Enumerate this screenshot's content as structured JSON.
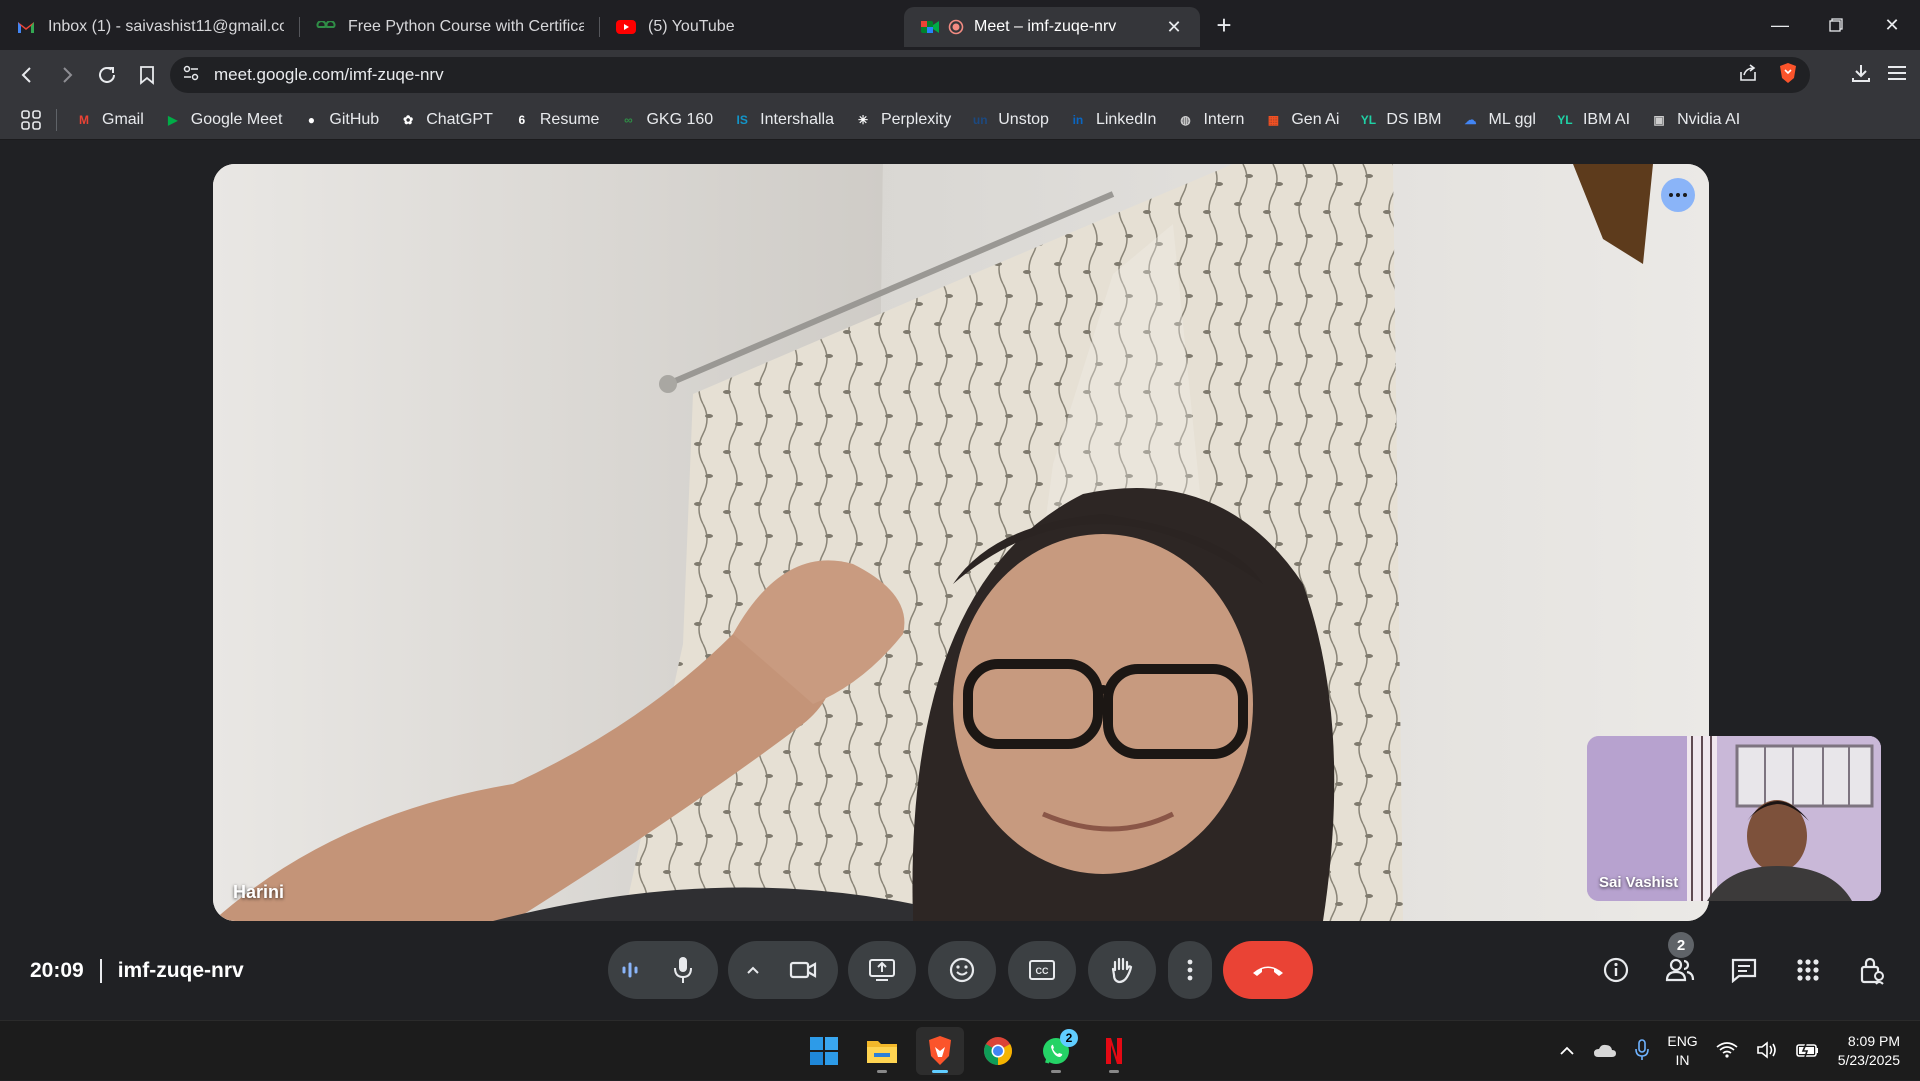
{
  "browser": {
    "tabs": [
      {
        "title": "Inbox (1) - saivashist11@gmail.com",
        "icon": "gmail-icon",
        "active": false
      },
      {
        "title": "Free Python Course with Certificate",
        "icon": "gfg-icon",
        "active": false
      },
      {
        "title": "(5) YouTube",
        "icon": "youtube-icon",
        "active": false
      },
      {
        "title": "Meet – imf-zuqe-nrv",
        "icon": "meet-icon",
        "active": true
      }
    ],
    "url": "meet.google.com/imf-zuqe-nrv",
    "bookmarks": [
      {
        "label": "Gmail",
        "icon": "gmail-icon",
        "color": "#ea4335"
      },
      {
        "label": "Google Meet",
        "icon": "meet-icon",
        "color": "#00ac47"
      },
      {
        "label": "GitHub",
        "icon": "github-icon",
        "color": "#ffffff"
      },
      {
        "label": "ChatGPT",
        "icon": "openai-icon",
        "color": "#ffffff"
      },
      {
        "label": "Resume",
        "icon": "resume-icon",
        "color": "#ffffff"
      },
      {
        "label": "GKG 160",
        "icon": "gfg-icon",
        "color": "#2f8d46"
      },
      {
        "label": "Intershalla",
        "icon": "internshala-icon",
        "color": "#1295c9"
      },
      {
        "label": "Perplexity",
        "icon": "perplexity-icon",
        "color": "#ffffff"
      },
      {
        "label": "Unstop",
        "icon": "unstop-icon",
        "color": "#1c4980"
      },
      {
        "label": "LinkedIn",
        "icon": "linkedin-icon",
        "color": "#0a66c2"
      },
      {
        "label": "Intern",
        "icon": "globe-icon",
        "color": "#cccccc"
      },
      {
        "label": "Gen Ai",
        "icon": "microsoft-icon",
        "color": "#f25022"
      },
      {
        "label": "DS IBM",
        "icon": "ibm-skills-icon",
        "color": "#1fd1a5"
      },
      {
        "label": "ML ggl",
        "icon": "gcloud-icon",
        "color": "#4285f4"
      },
      {
        "label": "IBM AI",
        "icon": "ibm-skills-icon",
        "color": "#1fd1a5"
      },
      {
        "label": "Nvidia AI",
        "icon": "nvidia-icon",
        "color": "#cccccc"
      }
    ]
  },
  "meet": {
    "main_participant": "Harini",
    "self_participant": "Sai Vashist",
    "time": "20:09",
    "meeting_code": "imf-zuqe-nrv",
    "participant_count": "2",
    "end_call_color": "#ea4335",
    "accent": "#8ab4f8"
  },
  "taskbar": {
    "apps": [
      "windows-start-icon",
      "file-explorer-icon",
      "brave-icon",
      "chrome-icon",
      "whatsapp-icon",
      "netflix-icon"
    ],
    "whatsapp_badge": "2",
    "lang_top": "ENG",
    "lang_bottom": "IN",
    "time": "8:09 PM",
    "date": "5/23/2025"
  }
}
